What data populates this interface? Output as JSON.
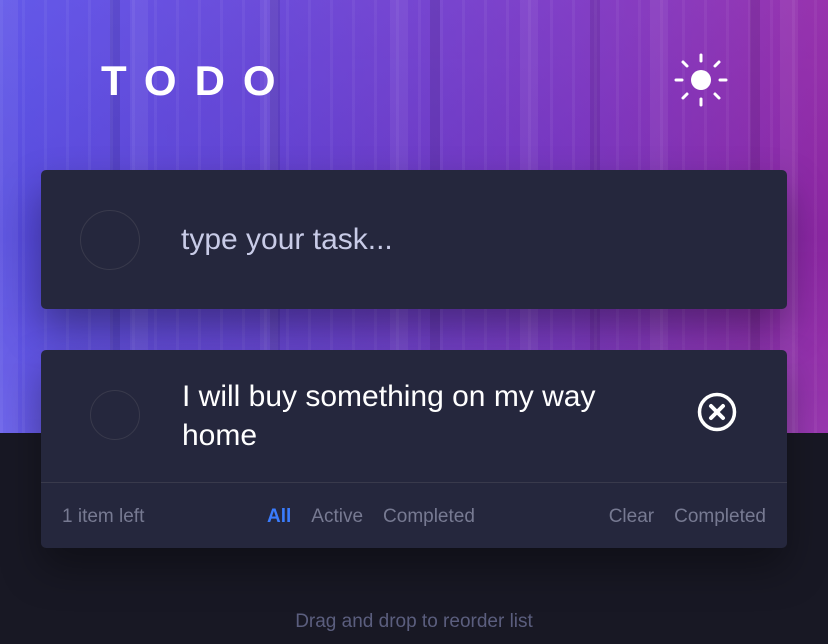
{
  "header": {
    "title": "TODO",
    "theme_toggle_icon": "sun-icon"
  },
  "new_todo": {
    "placeholder": "type your task...",
    "value": ""
  },
  "todos": [
    {
      "text": "I will buy something on my way home",
      "completed": false,
      "delete_icon": "close-circle-icon"
    }
  ],
  "footer": {
    "items_left": "1 item left",
    "filters": [
      {
        "label": "All",
        "active": true
      },
      {
        "label": "Active",
        "active": false
      },
      {
        "label": "Completed",
        "active": false
      }
    ],
    "clear_label_1": "Clear",
    "clear_label_2": "Completed"
  },
  "hint": "Drag and drop to reorder list",
  "colors": {
    "page_bg": "#181824",
    "card_bg": "#25273d",
    "accent": "#3a7cfd",
    "muted_text": "#777a92",
    "hint_text": "#5b5e7e",
    "gradient_start": "#5a50e8",
    "gradient_end": "#9228a9"
  }
}
